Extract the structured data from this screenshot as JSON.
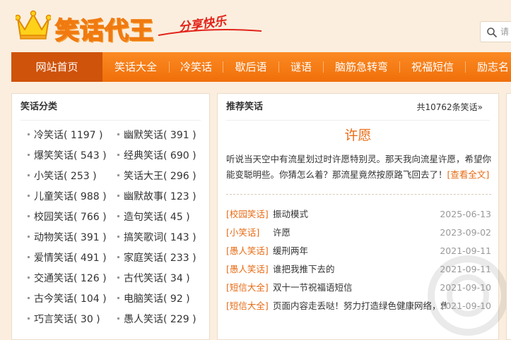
{
  "header": {
    "logo_title": "笑话代王",
    "slogan": "分享快乐",
    "search_placeholder": "请"
  },
  "nav": {
    "items": [
      "网站首页",
      "笑话大全",
      "冷笑话",
      "歇后语",
      "谜语",
      "脑筋急转弯",
      "祝福短信",
      "励志名"
    ]
  },
  "sidebar": {
    "title": "笑话分类",
    "categories": [
      "冷笑话( 1197 )",
      "幽默笑话( 391 )",
      "爆笑笑话( 543 )",
      "经典笑话( 690 )",
      "小笑话( 253 )",
      "笑话大王( 296 )",
      "儿童笑话( 988 )",
      "幽默故事( 123 )",
      "校园笑话( 766 )",
      "造句笑话( 45 )",
      "动物笑话( 391 )",
      "搞笑歌词( 143 )",
      "爱情笑话( 491 )",
      "家庭笑话( 233 )",
      "交通笑话( 126 )",
      "古代笑话( 34 )",
      "古今笑话( 104 )",
      "电脑笑话( 92 )",
      "巧言笑话( 30 )",
      "愚人笑话( 229 )"
    ]
  },
  "recommend": {
    "title": "推荐笑话",
    "total": "共10762条笑话»",
    "featured_title": "许愿",
    "featured_text": "听说当天空中有流星划过时许愿特别灵。那天我向流星许愿，希望你能变聪明些。你猜怎么着？那流星竟然按原路飞回去了！",
    "read_more": "[查看全文]",
    "list": [
      {
        "category": "[校园笑话]",
        "title": "振动模式",
        "date": "2025-06-13"
      },
      {
        "category": "[小笑话]",
        "title": "许愿",
        "date": "2023-09-02"
      },
      {
        "category": "[愚人笑话]",
        "title": "缓刑两年",
        "date": "2021-09-11"
      },
      {
        "category": "[愚人笑话]",
        "title": "谁把我推下去的",
        "date": "2021-09-11"
      },
      {
        "category": "[短信大全]",
        "title": "双十一节祝福语短信",
        "date": "2021-09-10"
      },
      {
        "category": "[短信大全]",
        "title": "页面内容走丢哒！努力打造绿色健康网络，传",
        "date": "2021-09-10"
      }
    ]
  },
  "colors": {
    "accent": "#f07a10",
    "nav_active": "#cf530a",
    "link_orange": "#e86a13",
    "background": "#fbeede"
  }
}
